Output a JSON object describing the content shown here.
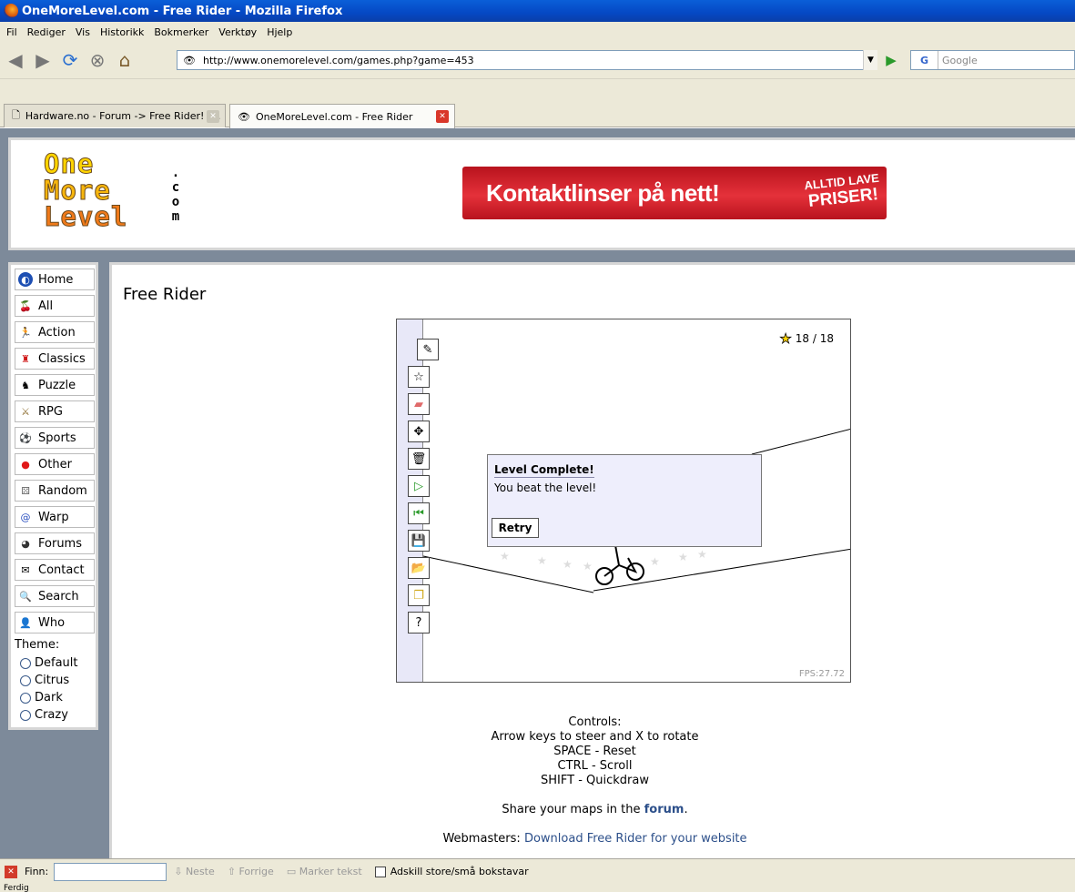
{
  "window": {
    "title": "OneMoreLevel.com - Free Rider - Mozilla Firefox"
  },
  "menu": [
    "Fil",
    "Rediger",
    "Vis",
    "Historikk",
    "Bokmerker",
    "Verktøy",
    "Hjelp"
  ],
  "navbar": {
    "url": "http://www.onemorelevel.com/games.php?game=453",
    "search_placeholder": "Google",
    "search_engine": "G"
  },
  "tabs": [
    {
      "label": "Hardware.no - Forum -> Free Rider! -...",
      "active": false
    },
    {
      "label": "OneMoreLevel.com - Free Rider",
      "active": true
    }
  ],
  "site": {
    "logo": {
      "line1": "One",
      "line2": "More",
      "line3": "Level",
      "suffix": ".com"
    },
    "ad": {
      "text": "Kontaktlinser på nett!",
      "badge_line1": "ALLTID LAVE",
      "badge_line2": "PRISER!"
    }
  },
  "sidebar": {
    "items": [
      {
        "label": "Home",
        "icon": "home-icon"
      },
      {
        "label": "All",
        "icon": "cherries-icon"
      },
      {
        "label": "Action",
        "icon": "runner-icon"
      },
      {
        "label": "Classics",
        "icon": "mario-icon"
      },
      {
        "label": "Puzzle",
        "icon": "chess-icon"
      },
      {
        "label": "RPG",
        "icon": "sword-icon"
      },
      {
        "label": "Sports",
        "icon": "soccer-ball-icon"
      },
      {
        "label": "Other",
        "icon": "ghost-icon"
      },
      {
        "label": "Random",
        "icon": "dice-icon"
      },
      {
        "label": "Warp",
        "icon": "spiral-icon"
      },
      {
        "label": "Forums",
        "icon": "pacman-icon"
      },
      {
        "label": "Contact",
        "icon": "envelope-icon"
      },
      {
        "label": "Search",
        "icon": "magnifier-icon"
      },
      {
        "label": "Who",
        "icon": "person-icon"
      }
    ],
    "theme": {
      "label": "Theme:",
      "options": [
        "Default",
        "Citrus",
        "Dark",
        "Crazy"
      ]
    }
  },
  "main": {
    "title": "Free Rider",
    "game": {
      "stars": "18 / 18",
      "fps": "FPS:27.72",
      "dialog": {
        "title": "Level Complete!",
        "message": "You beat the level!",
        "button": "Retry"
      },
      "tools": [
        "pencil-icon",
        "star-icon",
        "eraser-icon",
        "move-icon",
        "trash-icon",
        "play-icon",
        "restart-icon",
        "save-icon",
        "open-folder-icon",
        "copy-icon",
        "help-icon"
      ]
    },
    "controls": {
      "heading": "Controls:",
      "lines": [
        "Arrow keys to steer and X to rotate",
        "SPACE - Reset",
        "CTRL - Scroll",
        "SHIFT - Quickdraw"
      ],
      "share_prefix": "Share your maps in the ",
      "share_link": "forum",
      "share_suffix": ".",
      "webmasters_prefix": "Webmasters: ",
      "webmasters_link": "Download Free Rider for your website"
    }
  },
  "findbar": {
    "label": "Finn:",
    "next": "Neste",
    "prev": "Forrige",
    "highlight": "Marker tekst",
    "match_case": "Adskill store/små bokstavar"
  },
  "status": {
    "text": "Ferdig"
  },
  "colors": {
    "titlebar": "#0548c4",
    "site_bg": "#7d8a9a",
    "ad_red": "#c8202a",
    "dialog_bg": "#eeeefc",
    "link": "#2c4f8a"
  }
}
